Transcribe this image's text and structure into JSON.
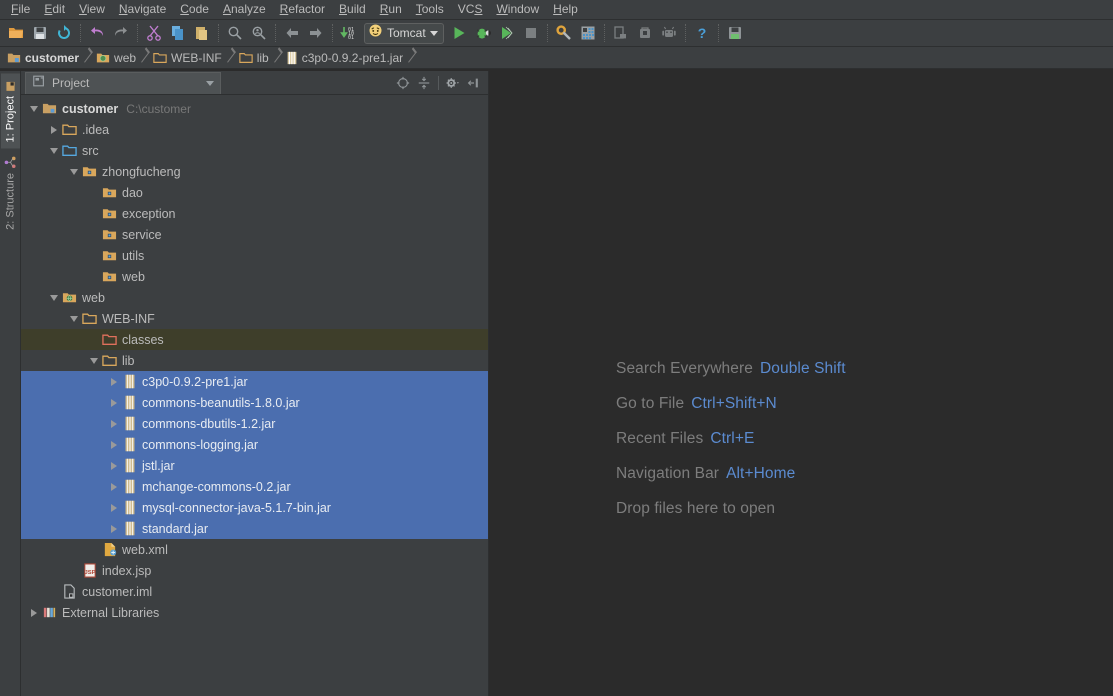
{
  "menubar": {
    "items": [
      {
        "label": "File",
        "mnemonic": "F"
      },
      {
        "label": "Edit",
        "mnemonic": "E"
      },
      {
        "label": "View",
        "mnemonic": "V"
      },
      {
        "label": "Navigate",
        "mnemonic": "N"
      },
      {
        "label": "Code",
        "mnemonic": "C"
      },
      {
        "label": "Analyze",
        "mnemonic": "A"
      },
      {
        "label": "Refactor",
        "mnemonic": "R"
      },
      {
        "label": "Build",
        "mnemonic": "B"
      },
      {
        "label": "Run",
        "mnemonic": "R"
      },
      {
        "label": "Tools",
        "mnemonic": "T"
      },
      {
        "label": "VCS",
        "mnemonic": "S"
      },
      {
        "label": "Window",
        "mnemonic": "W"
      },
      {
        "label": "Help",
        "mnemonic": "H"
      }
    ]
  },
  "toolbar": {
    "run_config": {
      "label": "Tomcat",
      "icon": "tomcat-icon"
    },
    "buttons": [
      {
        "name": "open-project-icon"
      },
      {
        "name": "save-all-icon"
      },
      {
        "name": "synchronize-icon"
      },
      {
        "name": "undo-icon"
      },
      {
        "name": "redo-icon"
      },
      {
        "name": "cut-icon"
      },
      {
        "name": "copy-icon"
      },
      {
        "name": "paste-icon"
      },
      {
        "name": "find-icon"
      },
      {
        "name": "replace-icon"
      },
      {
        "name": "back-icon"
      },
      {
        "name": "forward-icon"
      },
      {
        "name": "compile-icon"
      },
      {
        "name": "run-icon"
      },
      {
        "name": "debug-icon"
      },
      {
        "name": "run-with-coverage-icon"
      },
      {
        "name": "stop-icon"
      },
      {
        "name": "settings-icon"
      },
      {
        "name": "project-structure-icon"
      },
      {
        "name": "avd-manager-icon"
      },
      {
        "name": "sdk-manager-icon"
      },
      {
        "name": "sync-gradle-icon"
      },
      {
        "name": "help-icon"
      },
      {
        "name": "save-icon"
      }
    ]
  },
  "breadcrumb": {
    "items": [
      {
        "label": "customer",
        "icon": "module-icon"
      },
      {
        "label": "web",
        "icon": "web-folder-icon"
      },
      {
        "label": "WEB-INF",
        "icon": "folder-icon"
      },
      {
        "label": "lib",
        "icon": "folder-icon"
      },
      {
        "label": "c3p0-0.9.2-pre1.jar",
        "icon": "jar-icon"
      }
    ]
  },
  "tool_tabs": {
    "left": [
      {
        "label": "1: Project",
        "active": true,
        "icon": "project-icon"
      },
      {
        "label": "2: Structure",
        "active": false,
        "icon": "structure-icon"
      }
    ]
  },
  "project_panel": {
    "tab_label": "Project",
    "tab_icon": "project-view-icon",
    "tools": [
      {
        "name": "scroll-from-source-icon"
      },
      {
        "name": "collapse-all-icon"
      },
      {
        "name": "settings-gear-icon"
      },
      {
        "name": "hide-panel-icon"
      }
    ],
    "tree": [
      {
        "label": "customer",
        "sub": "C:\\customer",
        "depth": 0,
        "arrow": "open",
        "icon": "module-icon",
        "bold": true,
        "state": "normal"
      },
      {
        "label": ".idea",
        "sub": "",
        "depth": 1,
        "arrow": "closed",
        "icon": "folder-icon",
        "bold": false,
        "state": "normal"
      },
      {
        "label": "src",
        "sub": "",
        "depth": 1,
        "arrow": "open",
        "icon": "source-root-icon",
        "bold": false,
        "state": "normal"
      },
      {
        "label": "zhongfucheng",
        "sub": "",
        "depth": 2,
        "arrow": "open",
        "icon": "package-icon",
        "bold": false,
        "state": "normal"
      },
      {
        "label": "dao",
        "sub": "",
        "depth": 3,
        "arrow": "none",
        "icon": "package-icon",
        "bold": false,
        "state": "normal"
      },
      {
        "label": "exception",
        "sub": "",
        "depth": 3,
        "arrow": "none",
        "icon": "package-icon",
        "bold": false,
        "state": "normal"
      },
      {
        "label": "service",
        "sub": "",
        "depth": 3,
        "arrow": "none",
        "icon": "package-icon",
        "bold": false,
        "state": "normal"
      },
      {
        "label": "utils",
        "sub": "",
        "depth": 3,
        "arrow": "none",
        "icon": "package-icon",
        "bold": false,
        "state": "normal"
      },
      {
        "label": "web",
        "sub": "",
        "depth": 3,
        "arrow": "none",
        "icon": "package-icon",
        "bold": false,
        "state": "normal"
      },
      {
        "label": "web",
        "sub": "",
        "depth": 1,
        "arrow": "open",
        "icon": "web-folder-icon",
        "bold": false,
        "state": "normal"
      },
      {
        "label": "WEB-INF",
        "sub": "",
        "depth": 2,
        "arrow": "open",
        "icon": "folder-icon",
        "bold": false,
        "state": "normal"
      },
      {
        "label": "classes",
        "sub": "",
        "depth": 3,
        "arrow": "none",
        "icon": "excluded-folder-icon",
        "bold": false,
        "state": "hovered"
      },
      {
        "label": "lib",
        "sub": "",
        "depth": 3,
        "arrow": "open",
        "icon": "folder-icon",
        "bold": false,
        "state": "normal"
      },
      {
        "label": "c3p0-0.9.2-pre1.jar",
        "sub": "",
        "depth": 4,
        "arrow": "closed",
        "icon": "jar-icon",
        "bold": false,
        "state": "selected"
      },
      {
        "label": "commons-beanutils-1.8.0.jar",
        "sub": "",
        "depth": 4,
        "arrow": "closed",
        "icon": "jar-icon",
        "bold": false,
        "state": "selected"
      },
      {
        "label": "commons-dbutils-1.2.jar",
        "sub": "",
        "depth": 4,
        "arrow": "closed",
        "icon": "jar-icon",
        "bold": false,
        "state": "selected"
      },
      {
        "label": "commons-logging.jar",
        "sub": "",
        "depth": 4,
        "arrow": "closed",
        "icon": "jar-icon",
        "bold": false,
        "state": "selected"
      },
      {
        "label": "jstl.jar",
        "sub": "",
        "depth": 4,
        "arrow": "closed",
        "icon": "jar-icon",
        "bold": false,
        "state": "selected"
      },
      {
        "label": "mchange-commons-0.2.jar",
        "sub": "",
        "depth": 4,
        "arrow": "closed",
        "icon": "jar-icon",
        "bold": false,
        "state": "selected"
      },
      {
        "label": "mysql-connector-java-5.1.7-bin.jar",
        "sub": "",
        "depth": 4,
        "arrow": "closed",
        "icon": "jar-icon",
        "bold": false,
        "state": "selected"
      },
      {
        "label": "standard.jar",
        "sub": "",
        "depth": 4,
        "arrow": "closed",
        "icon": "jar-icon",
        "bold": false,
        "state": "selected"
      },
      {
        "label": "web.xml",
        "sub": "",
        "depth": 3,
        "arrow": "none",
        "icon": "xml-file-icon",
        "bold": false,
        "state": "normal"
      },
      {
        "label": "index.jsp",
        "sub": "",
        "depth": 2,
        "arrow": "none",
        "icon": "jsp-file-icon",
        "bold": false,
        "state": "normal"
      },
      {
        "label": "customer.iml",
        "sub": "",
        "depth": 1,
        "arrow": "none",
        "icon": "iml-file-icon",
        "bold": false,
        "state": "normal"
      },
      {
        "label": "External Libraries",
        "sub": "",
        "depth": 0,
        "arrow": "closed",
        "icon": "libraries-icon",
        "bold": false,
        "state": "normal"
      }
    ]
  },
  "editor": {
    "hints": [
      {
        "action": "Search Everywhere",
        "shortcut": "Double Shift"
      },
      {
        "action": "Go to File",
        "shortcut": "Ctrl+Shift+N"
      },
      {
        "action": "Recent Files",
        "shortcut": "Ctrl+E"
      },
      {
        "action": "Navigation Bar",
        "shortcut": "Alt+Home"
      },
      {
        "action": "Drop files here to open",
        "shortcut": ""
      }
    ]
  },
  "colors": {
    "selection_blue": "#4b6eaf",
    "hover_olive": "#3e3e2a",
    "panel_bg": "#3c3f41",
    "editor_bg": "#2b2b2b",
    "shortcut_blue": "#5b8bd0",
    "text": "#bbbbbb"
  }
}
